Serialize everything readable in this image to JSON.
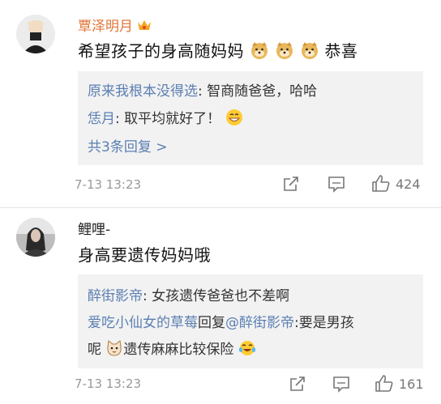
{
  "comments": [
    {
      "username": "覃泽明月",
      "badge_icon": "crown-badge-icon",
      "content": "希望孩子的身高随妈妈",
      "content_tail": "恭喜",
      "content_emojis": [
        "doge-emoji",
        "doge-emoji",
        "doge-emoji"
      ],
      "replies": [
        {
          "name": "原来我根本没得选",
          "text": ": 智商随爸爸，哈哈"
        },
        {
          "name": "恁月",
          "text": ": 取平均就好了！",
          "emoji": "grin-emoji"
        }
      ],
      "more_replies": "共3条回复 >",
      "time": "7-13 13:23",
      "likes": "424"
    },
    {
      "username": "鲤哩-",
      "content": "身高要遗传妈妈哦",
      "replies": [
        {
          "name": "醉街影帝",
          "text": ": 女孩遗传爸爸也不差啊"
        },
        {
          "name": "爱吃小仙女的草莓",
          "text": "回复",
          "mention": "@醉街影帝",
          "text2": ":要是男孩"
        },
        {
          "line_start": "呢",
          "emoji1": "cat-emoji",
          "text": "遗传麻麻比较保险",
          "emoji2": "laugh-cry-emoji"
        }
      ],
      "time": "7-13 13:23",
      "likes": "161"
    }
  ],
  "icons": {
    "share": "share-icon",
    "comment": "comment-icon",
    "like": "thumbs-up-icon"
  },
  "colors": {
    "link_blue": "#5b7fb2",
    "reply_bg": "#f2f2f2",
    "meta_gray": "#999999",
    "badge_orange": "#f5a623"
  }
}
